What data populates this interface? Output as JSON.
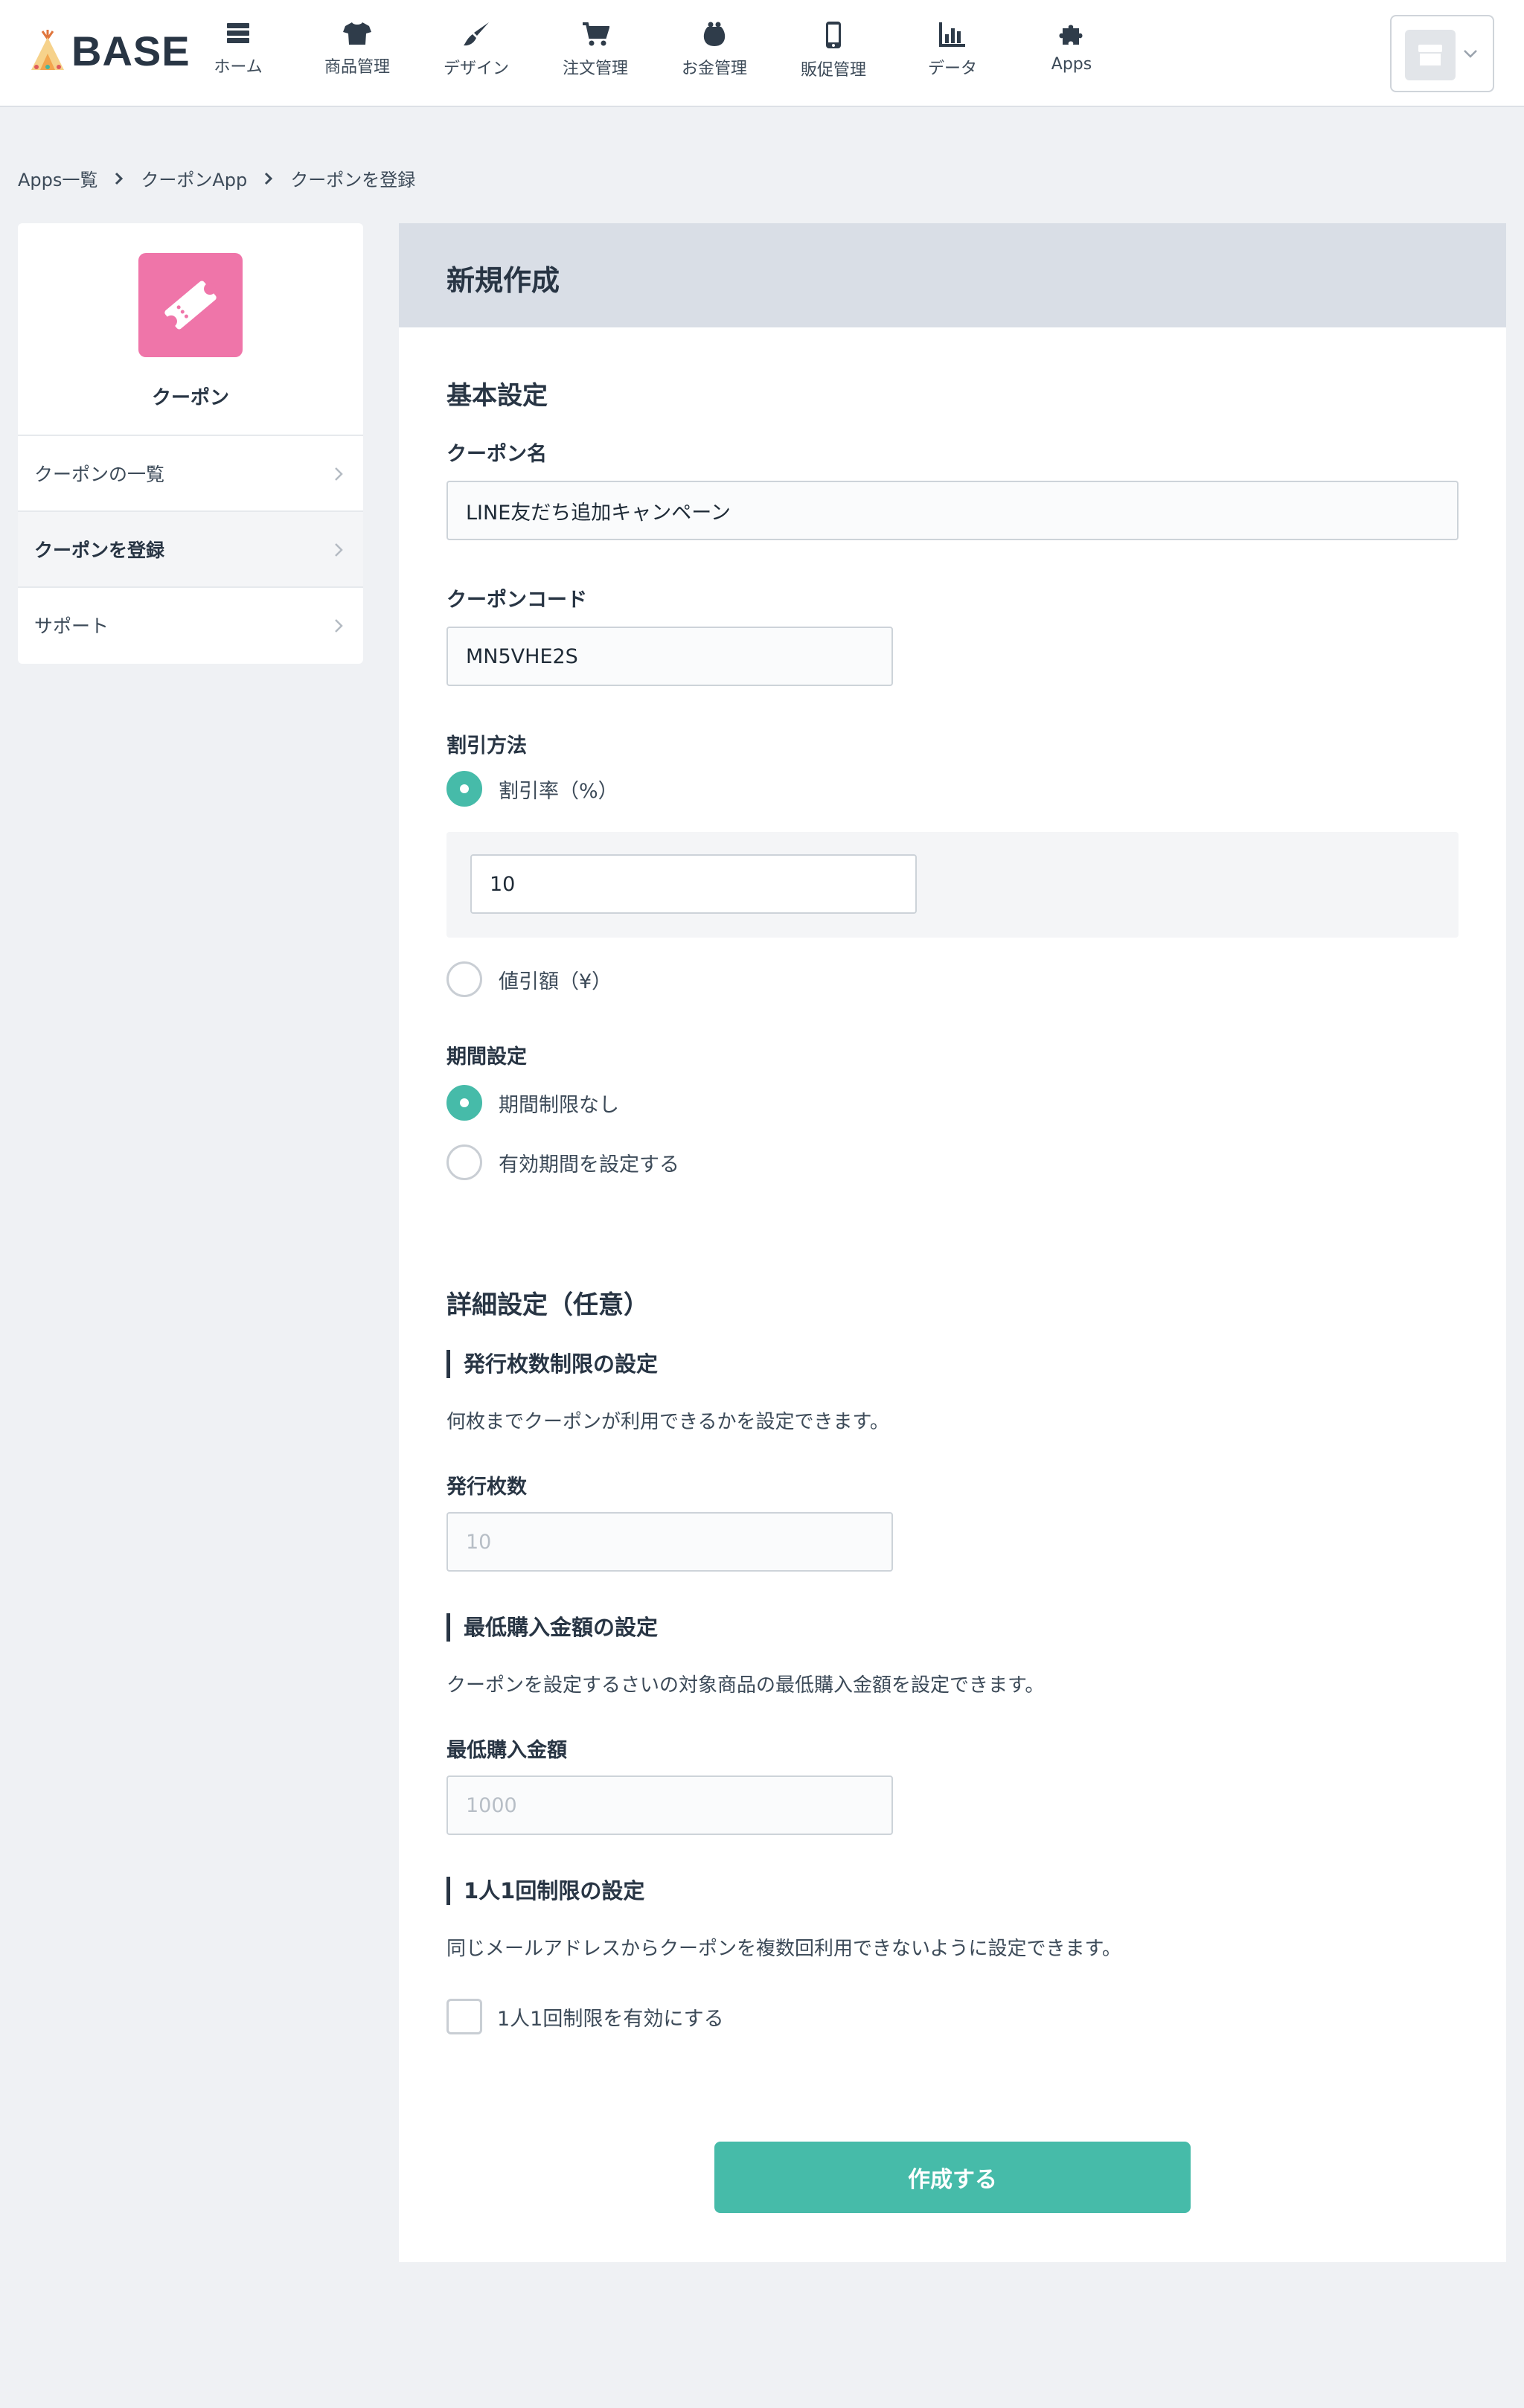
{
  "header": {
    "logo_text": "BASE",
    "nav": [
      {
        "label": "ホーム",
        "icon": "list-icon"
      },
      {
        "label": "商品管理",
        "icon": "tshirt-icon"
      },
      {
        "label": "デザイン",
        "icon": "brush-icon"
      },
      {
        "label": "注文管理",
        "icon": "cart-icon"
      },
      {
        "label": "お金管理",
        "icon": "purse-icon"
      },
      {
        "label": "販促管理",
        "icon": "smartphone-icon"
      },
      {
        "label": "データ",
        "icon": "bar-chart-icon"
      },
      {
        "label": "Apps",
        "icon": "puzzle-icon"
      }
    ],
    "shop_switcher_icon": "shop-icon"
  },
  "breadcrumb": [
    "Apps一覧",
    "クーポンApp",
    "クーポンを登録"
  ],
  "sidebar": {
    "app_icon": "ticket-icon",
    "app_icon_color": "#ef75a9",
    "app_name": "クーポン",
    "items": [
      {
        "label": "クーポンの一覧",
        "active": false
      },
      {
        "label": "クーポンを登録",
        "active": true
      },
      {
        "label": "サポート",
        "active": false
      }
    ]
  },
  "main": {
    "title": "新規作成",
    "basic": {
      "section_title": "基本設定",
      "coupon_name_label": "クーポン名",
      "coupon_name_value": "LINE友だち追加キャンペーン",
      "coupon_code_label": "クーポンコード",
      "coupon_code_value": "MN5VHE2S",
      "discount_label": "割引方法",
      "discount_rate_option": "割引率（%）",
      "discount_rate_value": "10",
      "discount_amount_option": "値引額（¥）",
      "discount_selected": "rate",
      "period_label": "期間設定",
      "period_none_option": "期間制限なし",
      "period_set_option": "有効期間を設定する",
      "period_selected": "none"
    },
    "detail": {
      "section_title": "詳細設定（任意）",
      "issue_limit_title": "発行枚数制限の設定",
      "issue_limit_desc": "何枚までクーポンが利用できるかを設定できます。",
      "issue_count_label": "発行枚数",
      "issue_count_placeholder": "10",
      "min_purchase_title": "最低購入金額の設定",
      "min_purchase_desc": "クーポンを設定するさいの対象商品の最低購入金額を設定できます。",
      "min_purchase_label": "最低購入金額",
      "min_purchase_placeholder": "1000",
      "one_per_person_title": "1人1回制限の設定",
      "one_per_person_desc": "同じメールアドレスからクーポンを複数回利用できないように設定できます。",
      "one_per_person_checkbox": "1人1回制限を有効にする",
      "one_per_person_checked": false
    },
    "submit_label": "作成する"
  },
  "colors": {
    "accent": "#46bba9",
    "app_tile": "#ef75a9",
    "heading": "#283544",
    "background": "#eff1f4"
  }
}
